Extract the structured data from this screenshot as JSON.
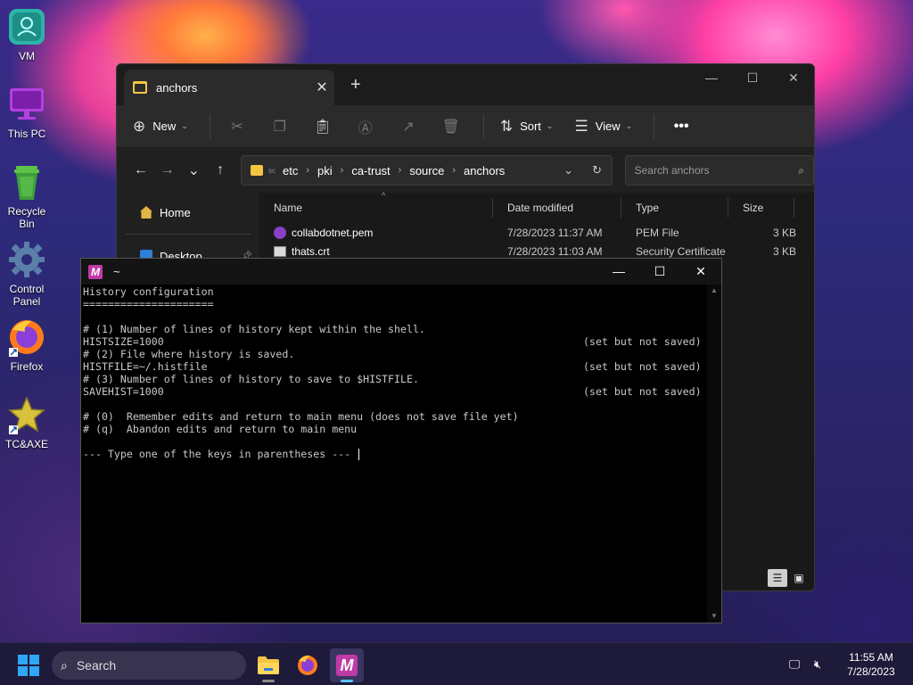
{
  "desktop": {
    "icons": [
      {
        "label": "VM"
      },
      {
        "label": "This PC"
      },
      {
        "label": "Recycle Bin"
      },
      {
        "label": "Control Panel"
      },
      {
        "label": "Firefox"
      },
      {
        "label": "TC&AXE"
      }
    ]
  },
  "explorer": {
    "tab_title": "anchors",
    "toolbar": {
      "new_label": "New",
      "sort_label": "Sort",
      "view_label": "View"
    },
    "address": {
      "prefix": "sc",
      "crumbs": [
        "etc",
        "pki",
        "ca-trust",
        "source",
        "anchors"
      ]
    },
    "search_placeholder": "Search anchors",
    "nav": {
      "home": "Home",
      "desktop": "Desktop"
    },
    "columns": {
      "name": "Name",
      "date": "Date modified",
      "type": "Type",
      "size": "Size"
    },
    "files": [
      {
        "name": "collabdotnet.pem",
        "date": "7/28/2023 11:37 AM",
        "type": "PEM File",
        "size": "3 KB"
      },
      {
        "name": "thats.crt",
        "date": "7/28/2023 11:03 AM",
        "type": "Security Certificate",
        "size": "3 KB"
      }
    ]
  },
  "terminal": {
    "title": "~",
    "lines": [
      {
        "text": "History configuration",
        "right": ""
      },
      {
        "text": "=====================",
        "right": ""
      },
      {
        "text": "",
        "right": ""
      },
      {
        "text": "# (1) Number of lines of history kept within the shell.",
        "right": ""
      },
      {
        "text": "HISTSIZE=1000",
        "right": "(set but not saved)"
      },
      {
        "text": "# (2) File where history is saved.",
        "right": ""
      },
      {
        "text": "HISTFILE=~/.histfile",
        "right": "(set but not saved)"
      },
      {
        "text": "# (3) Number of lines of history to save to $HISTFILE.",
        "right": ""
      },
      {
        "text": "SAVEHIST=1000",
        "right": "(set but not saved)"
      },
      {
        "text": "",
        "right": ""
      },
      {
        "text": "# (0)  Remember edits and return to main menu (does not save file yet)",
        "right": ""
      },
      {
        "text": "# (q)  Abandon edits and return to main menu",
        "right": ""
      },
      {
        "text": "",
        "right": ""
      }
    ],
    "prompt": "--- Type one of the keys in parentheses --- "
  },
  "taskbar": {
    "search_label": "Search",
    "time": "11:55 AM",
    "date": "7/28/2023"
  },
  "colors": {
    "accent": "#2fa7f5",
    "folder": "#f4c542",
    "terminal_logo": "#c03aa7"
  }
}
